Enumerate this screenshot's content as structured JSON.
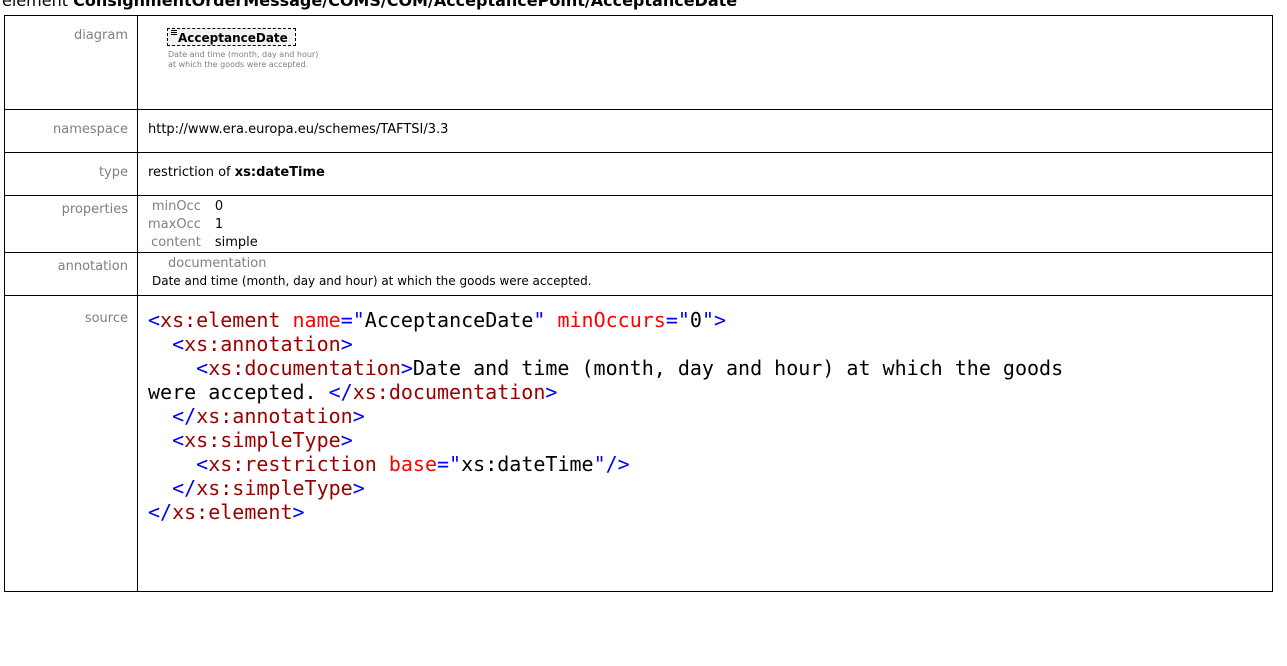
{
  "heading": {
    "prefix": "element",
    "path": "ConsignmentOrderMessage/COMS/COM/AcceptancePoint/AcceptanceDate"
  },
  "rows": {
    "diagram_label": "diagram",
    "namespace_label": "namespace",
    "type_label": "type",
    "properties_label": "properties",
    "annotation_label": "annotation",
    "source_label": "source"
  },
  "diagram": {
    "element_name": "AcceptanceDate",
    "documentation": "Date and time (month, day and hour) at which the goods were accepted."
  },
  "namespace": "http://www.era.europa.eu/schemes/TAFTSI/3.3",
  "type": {
    "prefix": "restriction of",
    "base": "xs:dateTime"
  },
  "properties": [
    {
      "key": "minOcc",
      "value": "0"
    },
    {
      "key": "maxOcc",
      "value": "1"
    },
    {
      "key": "content",
      "value": "simple"
    }
  ],
  "annotation": {
    "key": "documentation",
    "text": "Date and time (month, day and hour) at which the goods were accepted."
  },
  "source": {
    "element_tag": "xs:element",
    "name_attr": "name",
    "name_value": "AcceptanceDate",
    "minoccurs_attr": "minOccurs",
    "minoccurs_value": "0",
    "annotation_tag": "xs:annotation",
    "documentation_tag": "xs:documentation",
    "documentation_text_line1": "Date and time (month, day and hour) at which the goods",
    "documentation_text_line2": "were accepted. ",
    "simpletype_tag": "xs:simpleType",
    "restriction_tag": "xs:restriction",
    "base_attr": "base",
    "base_value": "xs:dateTime"
  },
  "colors": {
    "bracket": "#0000ff",
    "tag": "#990000",
    "attribute": "#ff0000",
    "label": "#808080"
  }
}
